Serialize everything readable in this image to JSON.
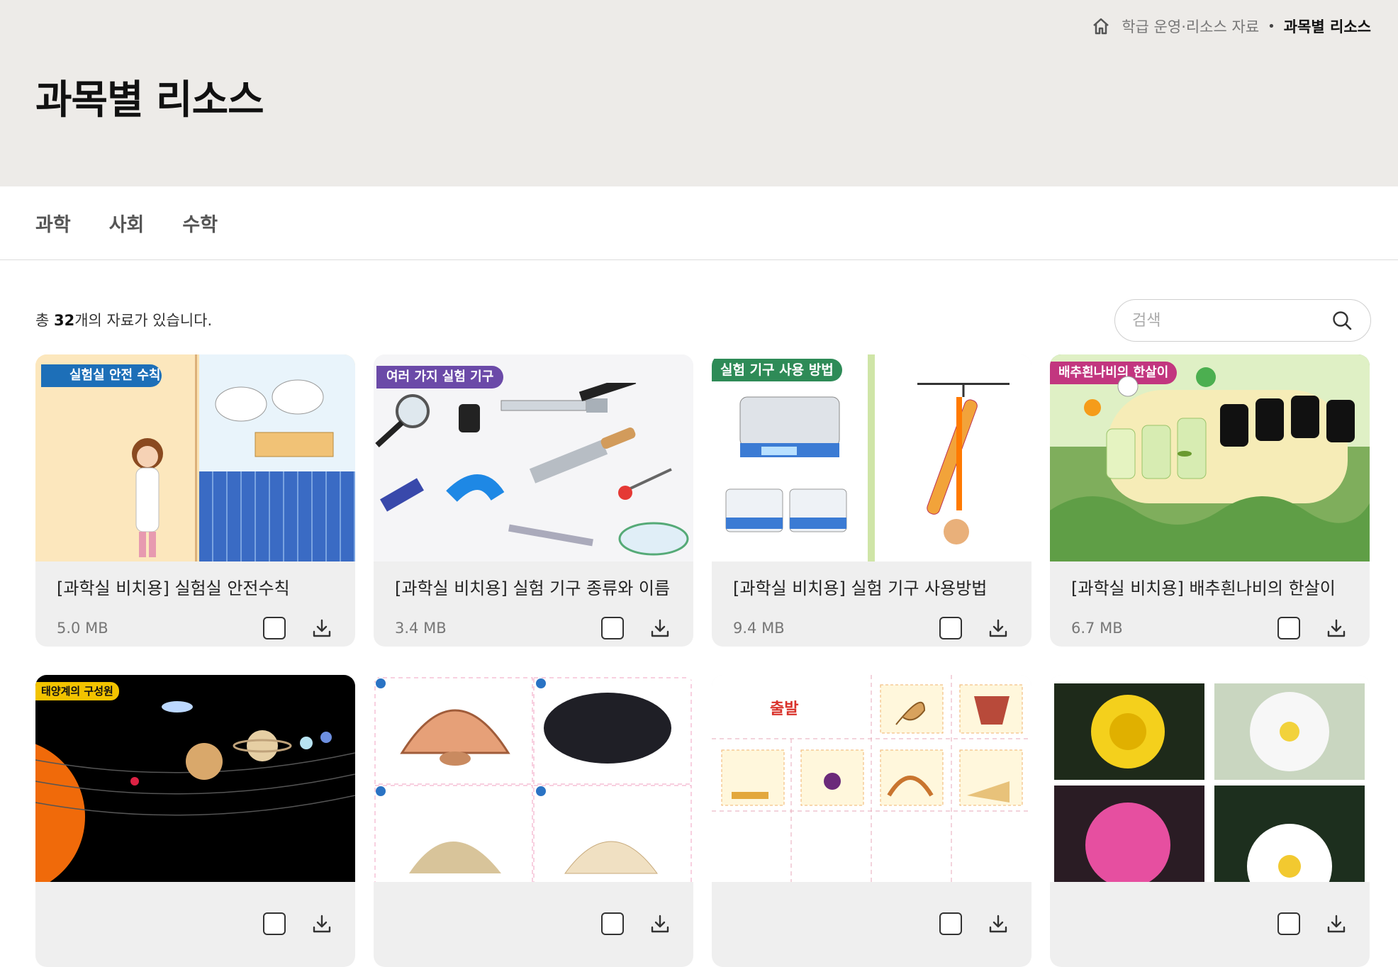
{
  "breadcrumb": {
    "home_icon": "home-icon",
    "parent": "학급 운영·리소스 자료",
    "separator": "•",
    "current": "과목별 리소스"
  },
  "page": {
    "title": "과목별 리소스"
  },
  "tabs": [
    {
      "label": "과학"
    },
    {
      "label": "사회"
    },
    {
      "label": "수학"
    }
  ],
  "results": {
    "prefix": "총 ",
    "count": "32",
    "suffix": "개의 자료가 있습니다."
  },
  "search": {
    "placeholder": "검색",
    "icon": "search-icon"
  },
  "cards": [
    {
      "title": "[과학실 비치용] 실험실 안전수칙",
      "size": "5.0 MB",
      "thumb_text": "실험실 안전 수칙"
    },
    {
      "title": "[과학실 비치용] 실험 기구 종류와 이름",
      "size": "3.4 MB",
      "thumb_text": "여러 가지 실험 기구"
    },
    {
      "title": "[과학실 비치용] 실험 기구 사용방법",
      "size": "9.4 MB",
      "thumb_text": "실험 기구 사용 방법"
    },
    {
      "title": "[과학실 비치용] 배추흰나비의 한살이",
      "size": "6.7 MB",
      "thumb_text": "배추흰나비의 한살이"
    },
    {
      "title": "",
      "size": "",
      "thumb_text": "태양계의 구성원"
    },
    {
      "title": "",
      "size": "",
      "thumb_text": ""
    },
    {
      "title": "",
      "size": "",
      "thumb_text": "출발"
    },
    {
      "title": "",
      "size": "",
      "thumb_text": ""
    }
  ]
}
